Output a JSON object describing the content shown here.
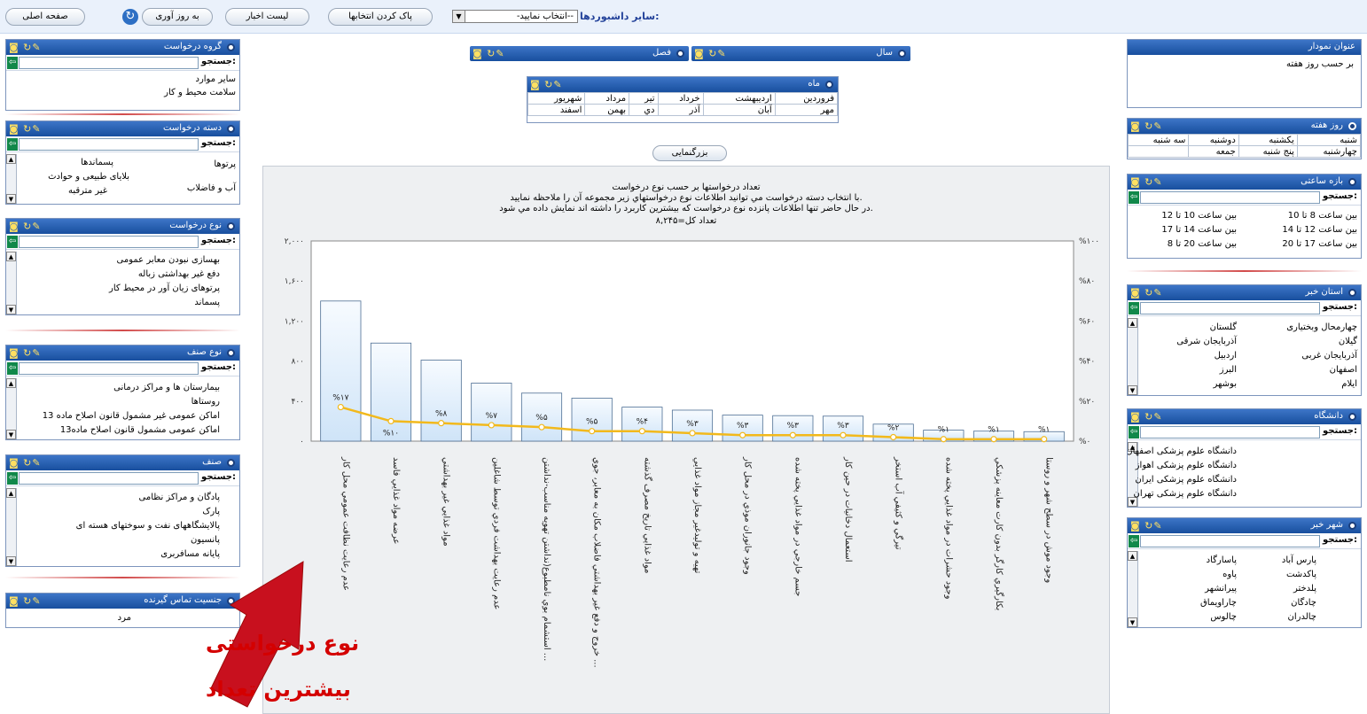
{
  "toolbar": {
    "home": "صفحه اصلی",
    "refresh": "به روز آوری",
    "news": "لیست اخبار",
    "clear": "پاک کردن انتخابها",
    "dash_label": "سایر داشبوردها:",
    "dash_value": "--انتخاب نمایید-"
  },
  "search_label": "جستجو:",
  "panels": {
    "group": {
      "title": "گروه درخواست",
      "items": [
        "سایر موارد",
        "سلامت محیط و کار"
      ]
    },
    "category": {
      "title": "دسته درخواست",
      "items": [
        "پرتوها",
        "پسماندها",
        "بلایای طبیعی و حوادث",
        "آب و فاضلاب",
        "غیر مترقبه"
      ]
    },
    "type": {
      "title": "نوع درخواست",
      "items": [
        "بهسازی نبودن معابر عمومی",
        "دفع غیر بهداشتی زباله",
        "پرتوهای زیان آور در محیط کار",
        "پسماند"
      ]
    },
    "guild_type": {
      "title": "نوع صنف",
      "items": [
        "بیمارستان ها و مراکز درمانی",
        "روستاها",
        "اماکن عمومی غیر مشمول قانون اصلاح ماده 13",
        "اماکن عمومی مشمول قانون اصلاح ماده13"
      ]
    },
    "guild": {
      "title": "صنف",
      "items": [
        "پادگان و مراکز نظامی",
        "پارک",
        "پالایشگاههای نفت و سوختهای هسته ای",
        "پانسیون",
        "پایانه مسافربری"
      ]
    },
    "gender": {
      "title": "جنسیت تماس گیرنده",
      "items": [
        "مرد"
      ]
    },
    "chart_title": {
      "title": "عنوان نمودار",
      "value": "بر حسب روز هفته"
    },
    "weekday": {
      "title": "روز هفته",
      "rows": [
        [
          "شنبه",
          "یکشنبه",
          "دوشنبه",
          "سه شنبه"
        ],
        [
          "چهارشنبه",
          "پنج شنبه",
          "جمعه",
          ""
        ]
      ]
    },
    "time": {
      "title": "بازه ساعتی",
      "rows": [
        [
          "بین ساعت 8 تا 10",
          "بین ساعت 10 تا 12"
        ],
        [
          "بین ساعت 12 تا 14",
          "بین ساعت 14 تا 17"
        ],
        [
          "بین ساعت 17 تا 20",
          "بین ساعت 20 تا 8"
        ]
      ]
    },
    "province": {
      "title": "استان خبر",
      "rows": [
        [
          "چهارمحال وبختیاری",
          "گلستان"
        ],
        [
          "گیلان",
          "آذربایجان شرقی"
        ],
        [
          "آذربایجان غربی",
          "اردبیل"
        ],
        [
          "اصفهان",
          "البرز"
        ],
        [
          "ایلام",
          "بوشهر"
        ]
      ]
    },
    "university": {
      "title": "دانشگاه",
      "items": [
        "دانشگاه علوم پزشکی اصفهان",
        "دانشگاه علوم پزشکی اهواز",
        "دانشگاه علوم پزشکی ایران",
        "دانشگاه علوم پزشکی تهران"
      ]
    },
    "city": {
      "title": "شهر خبر",
      "rows": [
        [
          "پارس آباد",
          "پاسارگاد"
        ],
        [
          "پاکدشت",
          "پاوه"
        ],
        [
          "پلدختر",
          "پیرانشهر"
        ],
        [
          "چادگان",
          "چاراویماق"
        ],
        [
          "چالدران",
          "چالوس"
        ]
      ]
    },
    "year": {
      "title": "سال"
    },
    "season": {
      "title": "فصل"
    },
    "month": {
      "title": "ماه",
      "rows": [
        [
          "فروردین",
          "اردیبهشت",
          "خرداد",
          "تیر",
          "مرداد",
          "شهریور"
        ],
        [
          "مهر",
          "آبان",
          "آذر",
          "دي",
          "بهمن",
          "اسفند"
        ]
      ]
    }
  },
  "zoom_button": "بزرگنمایی",
  "chart_header": {
    "line1": "تعداد درخواستها بر حسب نوع درخواست",
    "line2": ".با انتخاب دسته درخواست مي توانيد اطلاعات نوع درخواستهاي زير مجموعه آن را ملاحظه نماييد",
    "line3": ".در حال حاضر تنها اطلاعات پانزده نوع درخواست كه بيشترين كاربرد را داشته اند نمايش داده مي شود",
    "total": "تعداد کل=۸,۲۴۵"
  },
  "annotation": {
    "line1": "نوع درخواستی",
    "line2": "بیشترین تعداد"
  },
  "chart_data": {
    "type": "bar",
    "title": "تعداد درخواستها بر حسب نوع درخواست",
    "ylim": [
      0,
      2000
    ],
    "y_ticks": [
      "۰",
      "۴۰۰",
      "۸۰۰",
      "۱,۲۰۰",
      "۱,۶۰۰",
      "۲,۰۰۰"
    ],
    "y2_ticks": [
      "%۰",
      "%۲۰",
      "%۴۰",
      "%۶۰",
      "%۸۰",
      "%۱۰۰"
    ],
    "categories": [
      "عدم رعايت نظافت عمومي محل كار",
      "عرضه مواد غذايي فاسد",
      "مواد غذايي غير بهداشتي",
      "عدم رعايت بهداشت فردي توسط شاغلين",
      "استشمام بوي نامطبوع(نداشتن تهويه مناسب-نداشتن ...",
      "خروج و دفع غير بهداشتي فاضلاب مكان به معابر، جوي ...",
      "مواد غذايي تاريخ مصرف گذشته",
      "تهيه و توليدغير مجاز مواد غذايي",
      "وجود جانوران موذي در محل كار",
      "جسم خارجي در مواد غذايي پخته شده",
      "استعمال دخانيات در حين كار",
      "تيرگي و كثيفي آب استخر",
      "وجود حشرات در مواد غذايي پخته شده",
      "بكارگيري كارگر بدون كارت معاينه پزشكي",
      "وجود موش در سطح شهر و روستا"
    ],
    "values": [
      1400,
      980,
      810,
      580,
      480,
      430,
      340,
      310,
      260,
      255,
      250,
      170,
      110,
      100,
      95
    ],
    "percent": [
      17,
      10,
      9,
      8,
      7,
      5,
      5,
      4,
      3,
      3,
      3,
      2,
      1,
      1,
      1
    ],
    "percent_labels": [
      "%۱۷",
      "%۱۰",
      "%۸",
      "%۷",
      "%۵",
      "%۵",
      "%۴",
      "%۳",
      "%۳",
      "%۳",
      "%۳",
      "%۲",
      "%۱",
      "%۱",
      "%۱"
    ],
    "colors": {
      "bar": "#cfe4f8",
      "line": "#f2b91c"
    }
  }
}
